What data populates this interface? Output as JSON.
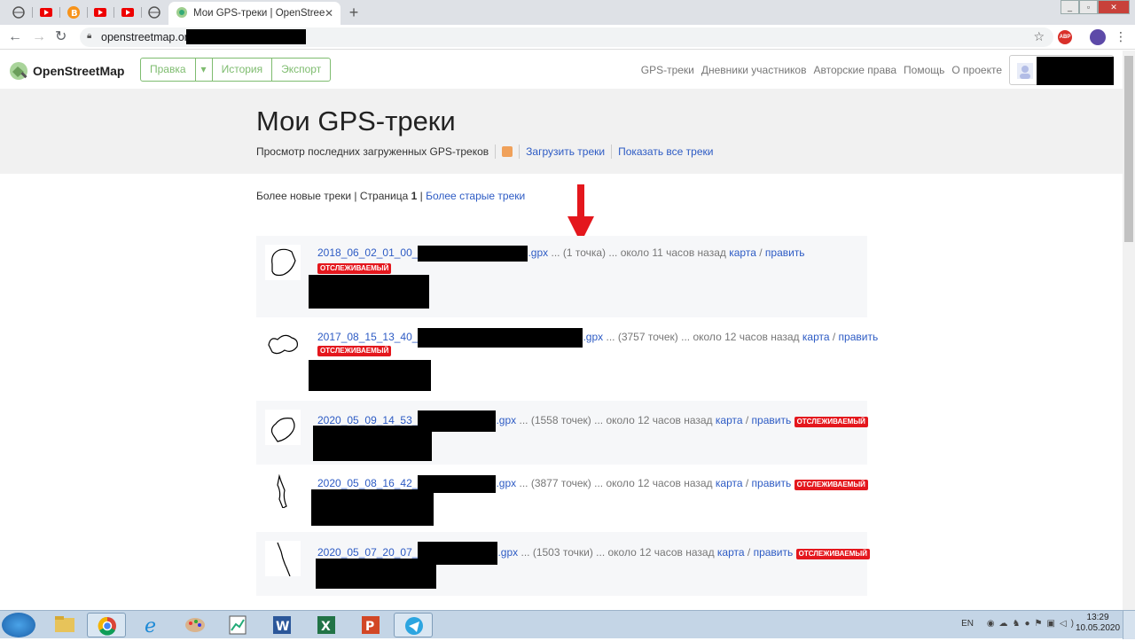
{
  "browser": {
    "tab_title": "Мои GPS-треки | OpenStreetMap",
    "url": "openstreetmap.org/"
  },
  "header": {
    "logo": "OpenStreetMap",
    "edit": "Правка",
    "history": "История",
    "export": "Экспорт",
    "nav": [
      "GPS-треки",
      "Дневники участников",
      "Авторские права",
      "Помощь",
      "О проекте"
    ]
  },
  "heading": {
    "title": "Мои GPS-треки",
    "subtitle": "Просмотр последних загруженных GPS-треков",
    "upload": "Загрузить треки",
    "show_all": "Показать все треки"
  },
  "pager": {
    "newer": "Более новые треки",
    "page_label": "Страница",
    "page_num": "1",
    "older": "Более старые треки"
  },
  "tracks": [
    {
      "name": "2018_06_02_01_00_",
      "ext": ".gpx",
      "info": " ... (1 точка) ... около 11 часов назад ",
      "map": "карта",
      "edit": "править",
      "badge": "ОТСЛЕЖИВАЕМЫЙ"
    },
    {
      "name": "2017_08_15_13_40_",
      "ext": ".gpx",
      "info": " ... (3757 точек) ... около 12 часов назад ",
      "map": "карта",
      "edit": "править",
      "badge": "ОТСЛЕЖИВАЕМЫЙ"
    },
    {
      "name": "2020_05_09_14_53_",
      "ext": ".gpx",
      "info": " ... (1558 точек) ... около 12 часов назад ",
      "map": "карта",
      "edit": "править",
      "badge": "ОТСЛЕЖИВАЕМЫЙ"
    },
    {
      "name": "2020_05_08_16_42_",
      "ext": ".gpx",
      "info": " ... (3877 точек) ... около 12 часов назад ",
      "map": "карта",
      "edit": "править",
      "badge": "ОТСЛЕЖИВАЕМЫЙ"
    },
    {
      "name": "2020_05_07_20_07_",
      "ext": ".gpx",
      "info": " ... (1503 точки) ... около 12 часов назад ",
      "map": "карта",
      "edit": "править",
      "badge": "ОТСЛЕЖИВАЕМЫЙ"
    }
  ],
  "taskbar": {
    "lang": "EN",
    "time": "13:29",
    "date": "10.05.2020"
  },
  "colors": {
    "accent": "#7ebc6f",
    "link": "#2d5bc4",
    "badge": "#e4171d",
    "arrow": "#e4171d"
  }
}
